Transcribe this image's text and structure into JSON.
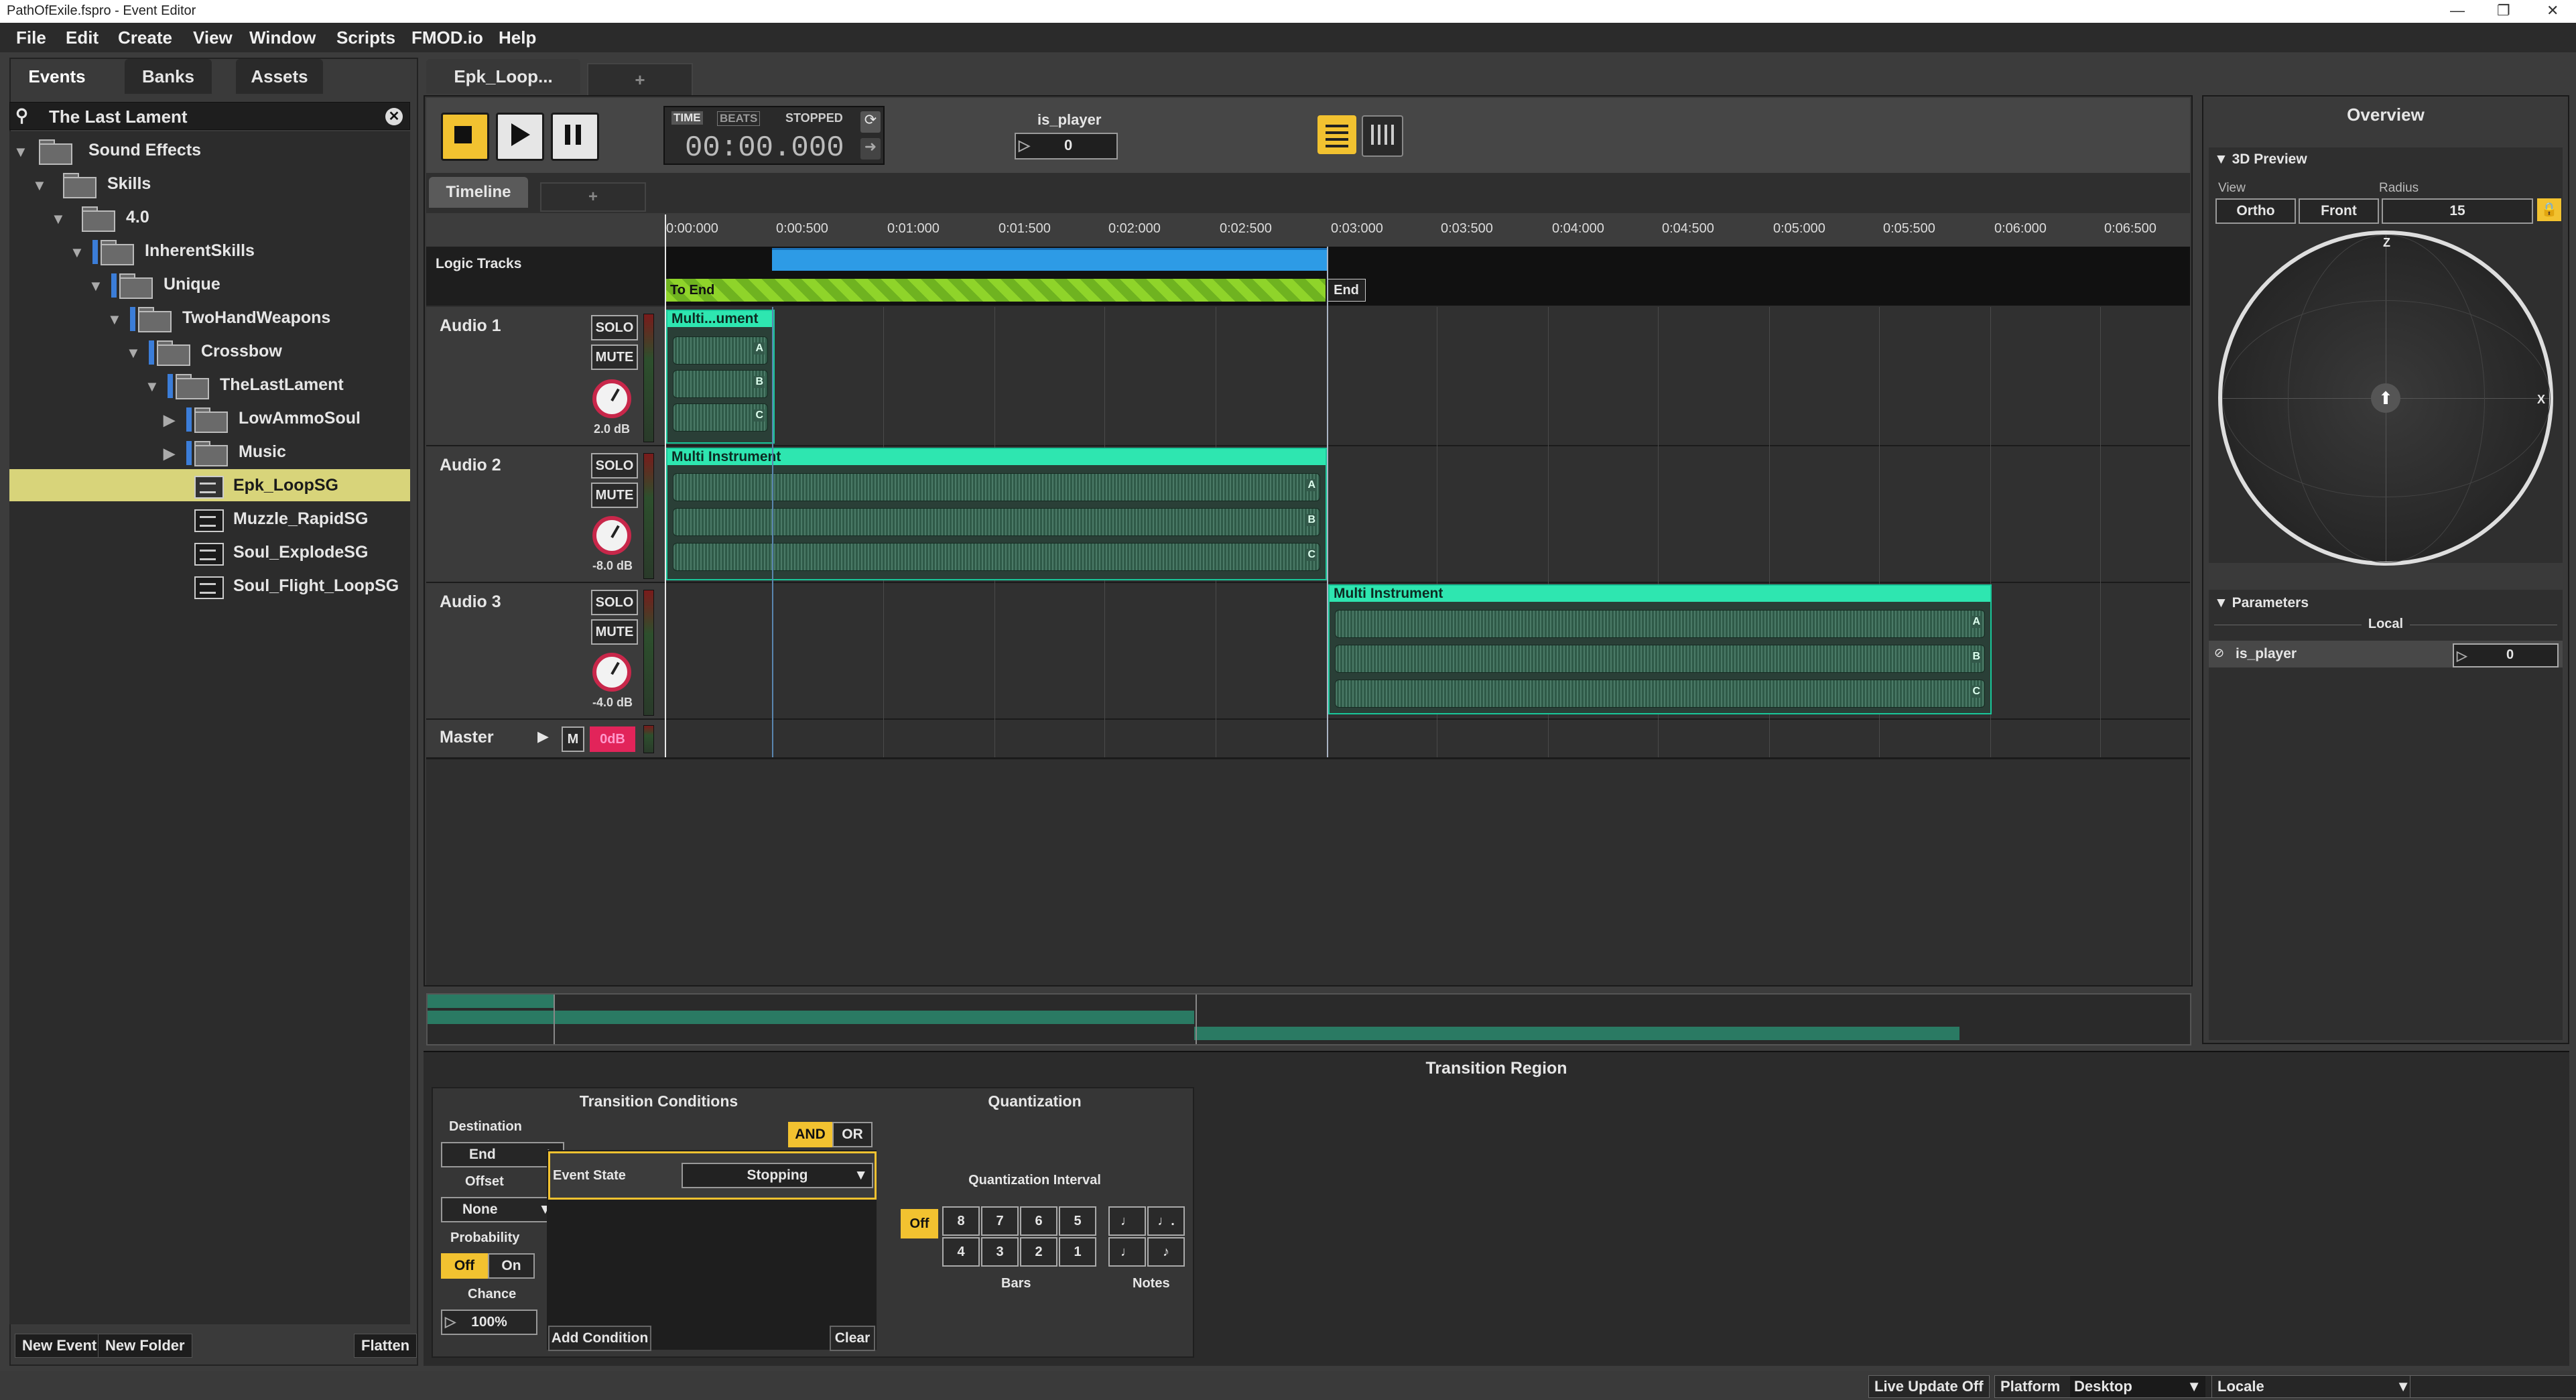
{
  "window": {
    "title": "PathOfExile.fspro - Event Editor",
    "controls": [
      "—",
      "❐",
      "✕"
    ]
  },
  "menu": [
    "File",
    "Edit",
    "Create",
    "View",
    "Window",
    "Scripts",
    "FMOD.io",
    "Help"
  ],
  "browser": {
    "tabs": [
      "Events",
      "Banks",
      "Assets"
    ],
    "search_value": "The Last Lament",
    "tree": [
      {
        "label": "Sound Effects",
        "type": "folder"
      },
      {
        "label": "Skills",
        "type": "folder"
      },
      {
        "label": "4.0",
        "type": "folder"
      },
      {
        "label": "InherentSkills",
        "type": "folder"
      },
      {
        "label": "Unique",
        "type": "folder"
      },
      {
        "label": "TwoHandWeapons",
        "type": "folder"
      },
      {
        "label": "Crossbow",
        "type": "folder"
      },
      {
        "label": "TheLastLament",
        "type": "folder"
      },
      {
        "label": "LowAmmoSoul",
        "type": "folder"
      },
      {
        "label": "Music",
        "type": "folder"
      },
      {
        "label": "Epk_LoopSG",
        "type": "event",
        "selected": true
      },
      {
        "label": "Muzzle_RapidSG",
        "type": "event"
      },
      {
        "label": "Soul_ExplodeSG",
        "type": "event"
      },
      {
        "label": "Soul_Flight_LoopSG",
        "type": "event"
      }
    ],
    "buttons": {
      "new_event": "New Event",
      "new_folder": "New Folder",
      "flatten": "Flatten"
    }
  },
  "editor": {
    "tab_title": "Epk_Loop...",
    "new_tab": "+",
    "time_label": "TIME",
    "beats_label": "BEATS",
    "state": "STOPPED",
    "time": "00:00.000",
    "param_name": "is_player",
    "param_value": "0",
    "timeline_tab": "Timeline",
    "timeline_add": "+",
    "ruler": [
      "0:00:000",
      "0:00:500",
      "0:01:000",
      "0:01:500",
      "0:02:000",
      "0:02:500",
      "0:03:000",
      "0:03:500",
      "0:04:000",
      "0:04:500",
      "0:05:000",
      "0:05:500",
      "0:06:000",
      "0:06:500"
    ],
    "logic_tracks": "Logic Tracks",
    "to_end": "To End",
    "end": "End",
    "tracks": [
      {
        "name": "Audio 1",
        "solo": "SOLO",
        "mute": "MUTE",
        "db": "2.0 dB",
        "instrument": "Multi...ument"
      },
      {
        "name": "Audio 2",
        "solo": "SOLO",
        "mute": "MUTE",
        "db": "-8.0 dB",
        "instrument": "Multi Instrument"
      },
      {
        "name": "Audio 3",
        "solo": "SOLO",
        "mute": "MUTE",
        "db": "-4.0 dB",
        "instrument": "Multi Instrument"
      }
    ],
    "wave_labels": [
      "A",
      "B",
      "C"
    ],
    "master": {
      "name": "Master",
      "m": "M",
      "db": "0dB"
    }
  },
  "overview": {
    "title": "Overview",
    "preview_title": "3D Preview",
    "view_label": "View",
    "radius_label": "Radius",
    "ortho": "Ortho",
    "front": "Front",
    "radius": "15",
    "axis_z": "Z",
    "axis_x": "X",
    "parameters_title": "Parameters",
    "local": "Local",
    "param_name": "is_player",
    "param_value": "0"
  },
  "transition": {
    "title": "Transition Region",
    "conditions_title": "Transition Conditions",
    "quantization_title": "Quantization",
    "destination_label": "Destination",
    "destination_value": "End",
    "offset_label": "Offset",
    "offset_value": "None",
    "probability_label": "Probability",
    "off": "Off",
    "on": "On",
    "chance_label": "Chance",
    "chance_value": "100%",
    "and": "AND",
    "or": "OR",
    "event_state_label": "Event State",
    "event_state_value": "Stopping",
    "add_condition": "Add Condition",
    "clear": "Clear",
    "quant_interval_label": "Quantization Interval",
    "quant_off": "Off",
    "bars_top": [
      "8",
      "7",
      "6",
      "5"
    ],
    "bars_bottom": [
      "4",
      "3",
      "2",
      "1"
    ],
    "notes_top": [
      "♩",
      "♩."
    ],
    "notes_bottom": [
      "♩",
      "♪"
    ],
    "bars_label": "Bars",
    "notes_label": "Notes"
  },
  "status": {
    "live_update": "Live Update Off",
    "platform_label": "Platform",
    "platform_value": "Desktop",
    "locale_label": "Locale"
  },
  "colors": {
    "accent_yellow": "#f2c230",
    "instrument": "#2ee6b0",
    "loop_region": "#2d9be6",
    "transition": "#8fd42a",
    "knob_ring": "#c8274a"
  }
}
